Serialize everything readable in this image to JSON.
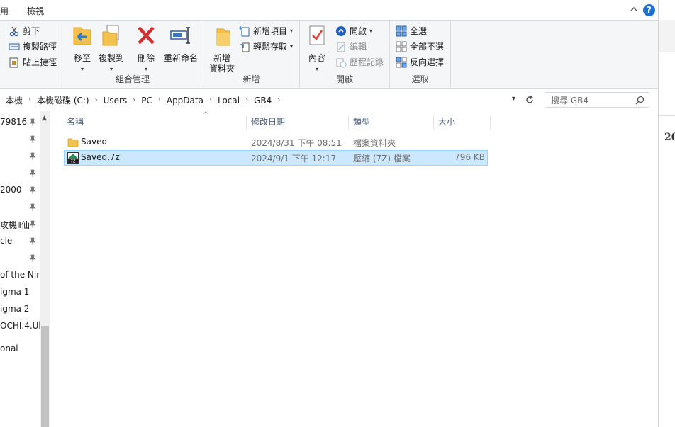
{
  "tabs": {
    "tab1": "用",
    "tab2": "檢視"
  },
  "ribbon": {
    "clipboard": {
      "cut": "剪下",
      "copy_path": "複製路徑",
      "paste_shortcut": "貼上捷徑"
    },
    "organize": {
      "move_to": "移至",
      "copy_to": "複製到",
      "delete": "刪除",
      "rename": "重新命名",
      "group_label": "組合管理"
    },
    "new": {
      "new_folder_line1": "新增",
      "new_folder_line2": "資料夾",
      "new_item": "新增項目",
      "easy_access": "輕鬆存取",
      "group_label": "新增"
    },
    "open": {
      "properties": "內容",
      "open": "開啟",
      "edit": "編輯",
      "history": "歷程記錄",
      "group_label": "開啟"
    },
    "select": {
      "select_all": "全選",
      "select_none": "全部不選",
      "invert": "反向選擇",
      "group_label": "選取"
    }
  },
  "address": {
    "crumbs": [
      "本機",
      "本機磁碟 (C:)",
      "Users",
      "PC",
      "AppData",
      "Local",
      "GB4"
    ],
    "search_placeholder": "搜尋 GB4"
  },
  "nav": {
    "items": [
      "79816",
      "",
      "",
      "2000",
      "",
      "攻機Ⅱ仙",
      "cle",
      "",
      "of the Nin",
      "igma 1",
      "igma 2",
      "OCHI.4.Ul",
      "onal"
    ]
  },
  "columns": {
    "name": "名稱",
    "modified": "修改日期",
    "type": "類型",
    "size": "大小"
  },
  "files": [
    {
      "name": "Saved",
      "modified": "2024/8/31 下午 08:51",
      "type": "檔案資料夾",
      "size": "",
      "icon": "folder-icon",
      "selected": false
    },
    {
      "name": "Saved.7z",
      "modified": "2024/9/1 下午 12:17",
      "type": "壓縮 (7Z) 檔案",
      "size": "796 KB",
      "icon": "7z-archive-icon",
      "selected": true
    }
  ],
  "right_strip": {
    "partial_text": "20"
  },
  "colors": {
    "selection": "#cce8ff",
    "selection_border": "#99d1ff",
    "header_text": "#4c607a",
    "help_blue": "#1d6fd1"
  }
}
